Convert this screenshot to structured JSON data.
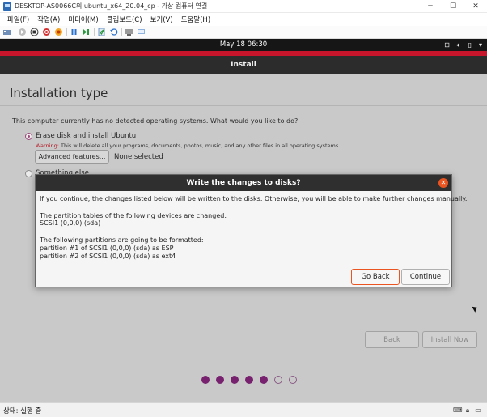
{
  "window": {
    "title": "DESKTOP-AS0066C의 ubuntu_x64_20.04_cp - 가상 컴퓨터 연결",
    "controls": [
      "minimize-icon",
      "maximize-icon",
      "close-icon"
    ]
  },
  "menu": {
    "items": [
      "파일(F)",
      "작업(A)",
      "미디어(M)",
      "클립보드(C)",
      "보기(V)",
      "도움말(H)"
    ]
  },
  "toolbar": {
    "icons": [
      "ctrl-alt-del-icon",
      "start-icon",
      "turn-off-icon",
      "shutdown-icon",
      "save-icon",
      "pause-icon",
      "reset-icon",
      "checkpoint-icon",
      "revert-icon",
      "enhanced-session-icon",
      "share-icon"
    ]
  },
  "topbar": {
    "clock": "May 18  06:30",
    "status_icons": [
      "network-icon",
      "volume-icon",
      "battery-icon",
      "power-menu-icon"
    ]
  },
  "header": {
    "title": "Install"
  },
  "installer": {
    "page_title": "Installation type",
    "question": "This computer currently has no detected operating systems. What would you like to do?",
    "option_erase_label": "Erase disk and install Ubuntu",
    "warning_prefix": "Warning:",
    "warning_text": " This will delete all your programs, documents, photos, music, and any other files in all operating systems.",
    "advanced_label": "Advanced features...",
    "none_selected": "None selected",
    "option_other_label": "Something else",
    "back_label": "Back",
    "install_label": "Install Now",
    "progress": {
      "total": 7,
      "completed": 5
    }
  },
  "dialog": {
    "title": "Write the changes to disks?",
    "intro": "If you continue, the changes listed below will be written to the disks. Otherwise, you will be able to make further changes manually.",
    "partition_tables_heading": "The partition tables of the following devices are changed:",
    "partition_tables_device": " SCSI1 (0,0,0) (sda)",
    "format_heading": "The following partitions are going to be formatted:",
    "format_line1": " partition #1 of SCSI1 (0,0,0) (sda) as ESP",
    "format_line2": " partition #2 of SCSI1 (0,0,0) (sda) as ext4",
    "go_back_label": "Go Back",
    "continue_label": "Continue"
  },
  "statusbar": {
    "text": "상태: 실행 중",
    "icons": [
      "keyboard-icon",
      "lock-icon",
      "monitor-icon"
    ]
  },
  "colors": {
    "ubuntu_orange": "#e95420",
    "accent_red": "#c7162b",
    "aubergine": "#77216f"
  }
}
